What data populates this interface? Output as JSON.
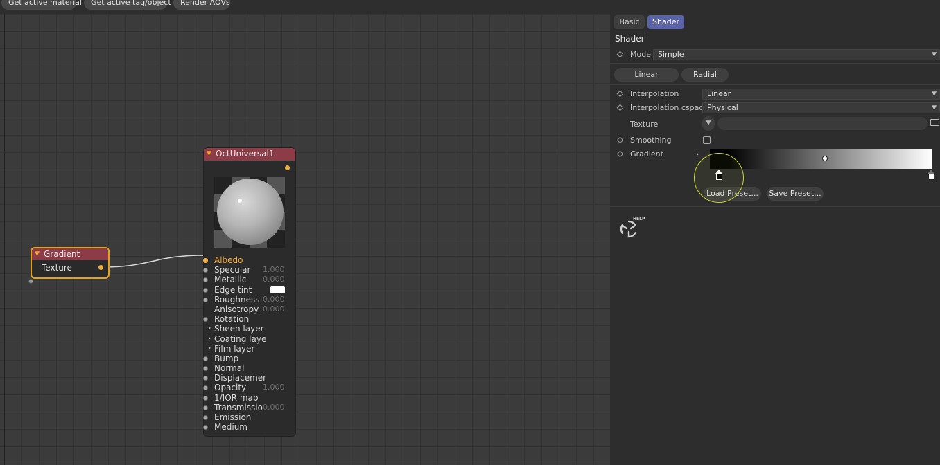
{
  "toolbar": {
    "get_active_material": "Get active material",
    "get_active_tag": "Get active tag/object",
    "render_aovs": "Render AOVs"
  },
  "nodes": {
    "gradient": {
      "title": "Gradient",
      "input": "Texture"
    },
    "octuniversal": {
      "title": "OctUniversal1",
      "pins": [
        {
          "label": "Albedo",
          "value": "",
          "highlight": true
        },
        {
          "label": "Specular",
          "value": "1.000"
        },
        {
          "label": "Metallic",
          "value": "0.000"
        },
        {
          "label": "Edge tint",
          "value": "",
          "swatch": "#ffffff"
        },
        {
          "label": "Roughness",
          "value": "0.000"
        },
        {
          "label": "Anisotropy",
          "value": "0.000",
          "nodot": true
        },
        {
          "label": "Rotation",
          "value": ""
        },
        {
          "label": "Sheen layer",
          "value": "",
          "group": true
        },
        {
          "label": "Coating layer",
          "value": "",
          "group": true
        },
        {
          "label": "Film layer",
          "value": "",
          "group": true
        },
        {
          "label": "Bump",
          "value": ""
        },
        {
          "label": "Normal",
          "value": ""
        },
        {
          "label": "Displacement",
          "value": ""
        },
        {
          "label": "Opacity",
          "value": "1.000"
        },
        {
          "label": "1/IOR map",
          "value": ""
        },
        {
          "label": "Transmissio",
          "value": "0.000"
        },
        {
          "label": "Emission",
          "value": ""
        },
        {
          "label": "Medium",
          "value": ""
        }
      ]
    }
  },
  "panel": {
    "tabs": {
      "basic": "Basic",
      "shader": "Shader"
    },
    "section": "Shader",
    "mode_label": "Mode",
    "mode_value": "Simple",
    "linear_btn": "Linear",
    "radial_btn": "Radial",
    "interpolation_label": "Interpolation",
    "interpolation_value": "Linear",
    "cspace_label": "Interpolation cspace",
    "cspace_value": "Physical",
    "texture_label": "Texture",
    "smoothing_label": "Smoothing",
    "gradient_label": "Gradient",
    "load_preset": "Load Preset...",
    "save_preset": "Save Preset...",
    "help_text": "HELP"
  },
  "colors": {
    "accent_tab": "#5a63a8",
    "node_header": "#8b3c47",
    "selection": "#e8a11b",
    "cursor_ring": "#c8d630"
  }
}
